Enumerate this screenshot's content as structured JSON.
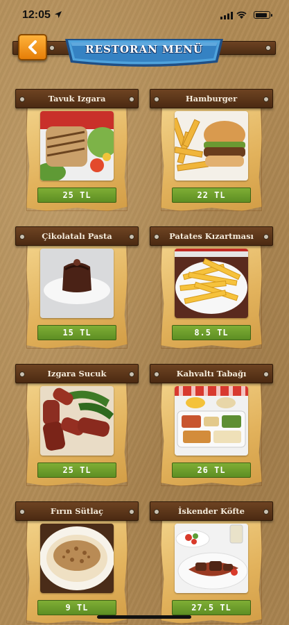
{
  "status_bar": {
    "time": "12:05"
  },
  "header": {
    "title": "RESTORAN MENÜ",
    "back_icon": "chevron-left-icon"
  },
  "colors": {
    "accent_orange": "#f39a1c",
    "banner_blue": "#3a86c7",
    "price_green": "#6a9b2a",
    "plank_brown": "#5a3419"
  },
  "menu": [
    {
      "name": "Tavuk Izgara",
      "price": "25 TL"
    },
    {
      "name": "Hamburger",
      "price": "22 TL"
    },
    {
      "name": "Çikolatalı Pasta",
      "price": "15 TL"
    },
    {
      "name": "Patates Kızartması",
      "price": "8.5 TL"
    },
    {
      "name": "Izgara Sucuk",
      "price": "25 TL"
    },
    {
      "name": "Kahvaltı Tabağı",
      "price": "26 TL"
    },
    {
      "name": "Fırın Sütlaç",
      "price": "9 TL"
    },
    {
      "name": "İskender Köfte",
      "price": "27.5 TL"
    }
  ]
}
